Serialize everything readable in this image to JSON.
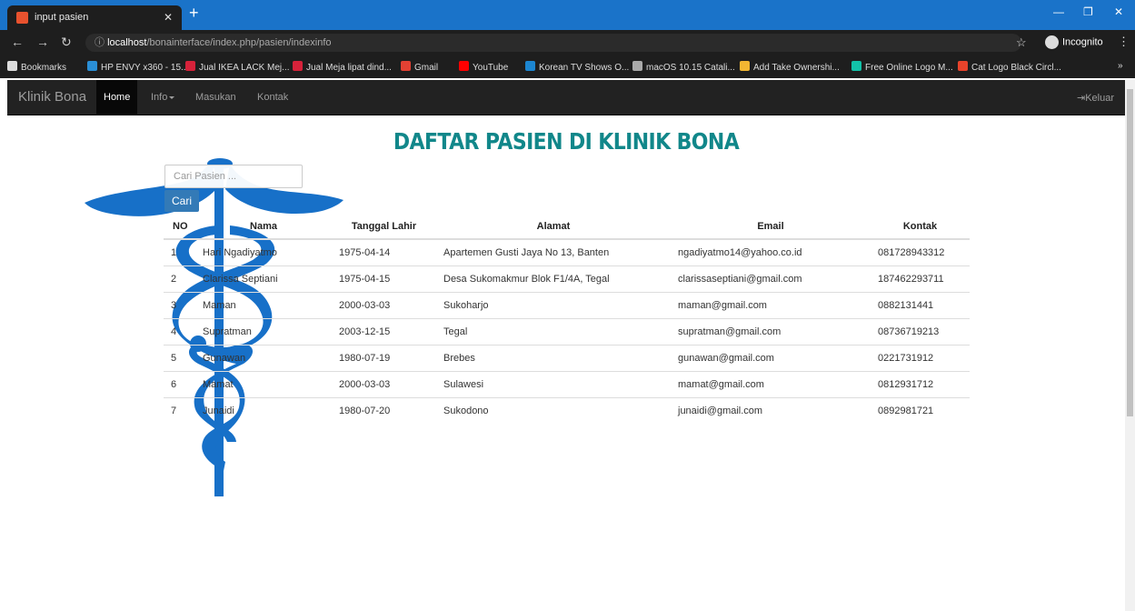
{
  "browser": {
    "tab_title": "input pasien",
    "url_host": "localhost",
    "url_path": "/bonainterface/index.php/pasien/indexinfo",
    "incognito_label": "Incognito",
    "bookmarks": [
      {
        "label": "Bookmarks",
        "color": "#dddddd"
      },
      {
        "label": "HP ENVY x360 - 15...",
        "color": "#2a8fd6"
      },
      {
        "label": "Jual IKEA LACK Mej...",
        "color": "#d6223a"
      },
      {
        "label": "Jual Meja lipat dind...",
        "color": "#d6223a"
      },
      {
        "label": "Gmail",
        "color": "#e34133"
      },
      {
        "label": "YouTube",
        "color": "#ff0000"
      },
      {
        "label": "Korean TV Shows O...",
        "color": "#1c86d1"
      },
      {
        "label": "macOS 10.15 Catali...",
        "color": "#aaaaaa"
      },
      {
        "label": "Add Take Ownershi...",
        "color": "#f2b632"
      },
      {
        "label": "Free Online Logo M...",
        "color": "#12c2a8"
      },
      {
        "label": "Cat Logo Black Circl...",
        "color": "#e8432b"
      }
    ]
  },
  "navbar": {
    "brand": "Klinik Bona",
    "items": [
      "Home",
      "Info",
      "Masukan",
      "Kontak"
    ],
    "logout": "Keluar"
  },
  "page_title": "DAFTAR PASIEN DI KLINIK BONA",
  "search": {
    "placeholder": "Cari Pasien ...",
    "button": "Cari"
  },
  "table": {
    "headers": [
      "NO",
      "Nama",
      "Tanggal Lahir",
      "Alamat",
      "Email",
      "Kontak"
    ],
    "rows": [
      [
        "1",
        "Hari Ngadiyatmo",
        "1975-04-14",
        "Apartemen Gusti Jaya No 13, Banten",
        "ngadiyatmo14@yahoo.co.id",
        "081728943312"
      ],
      [
        "2",
        "Clarissa Septiani",
        "1975-04-15",
        "Desa Sukomakmur Blok F1/4A, Tegal",
        "clarissaseptiani@gmail.com",
        "187462293711"
      ],
      [
        "3",
        "Maman",
        "2000-03-03",
        "Sukoharjo",
        "maman@gmail.com",
        "0882131441"
      ],
      [
        "4",
        "Supratman",
        "2003-12-15",
        "Tegal",
        "supratman@gmail.com",
        "08736719213"
      ],
      [
        "5",
        "Gunawan",
        "1980-07-19",
        "Brebes",
        "gunawan@gmail.com",
        "0221731912"
      ],
      [
        "6",
        "Mamat",
        "2000-03-03",
        "Sulawesi",
        "mamat@gmail.com",
        "0812931712"
      ],
      [
        "7",
        "Junaidi",
        "1980-07-20",
        "Sukodono",
        "junaidi@gmail.com",
        "0892981721"
      ]
    ]
  },
  "colors": {
    "title": "#11878a",
    "caduceus": "#1770c8",
    "button": "#337ab7"
  }
}
